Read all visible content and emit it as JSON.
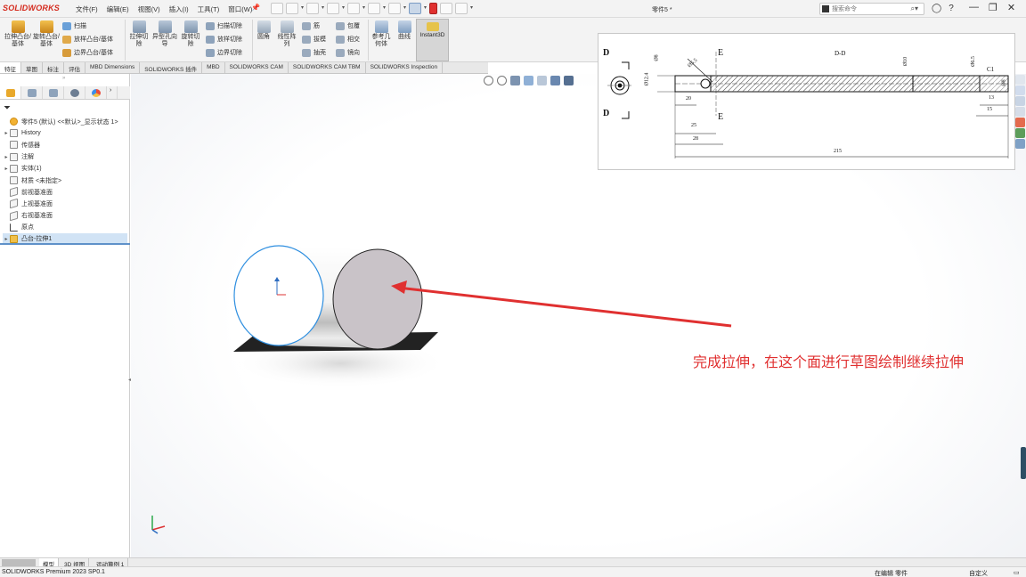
{
  "app": {
    "logo": "SOLIDWORKS",
    "document_title": "零件5 *"
  },
  "menu": [
    "文件(F)",
    "编辑(E)",
    "视图(V)",
    "插入(I)",
    "工具(T)",
    "窗口(W)"
  ],
  "search": {
    "placeholder": "搜索命令"
  },
  "ribbon": {
    "extrude_boss": "拉伸凸台/基体",
    "revolve_boss": "旋转凸台/基体",
    "sweep": "扫描",
    "loft_boss": "放样凸台/基体",
    "boundary_boss": "边界凸台/基体",
    "extrude_cut": "拉伸切除",
    "hole_wizard": "异型孔向导",
    "revolve_cut": "旋转切除",
    "sweep_cut": "扫描切除",
    "loft_cut": "放样切除",
    "boundary_cut": "边界切除",
    "fillet": "圆角",
    "linear_pattern": "线性阵列",
    "rib": "筋",
    "draft": "拔模",
    "shell": "抽壳",
    "wrap": "包覆",
    "intersect": "相交",
    "mirror": "镜向",
    "reference_geometry": "参考几何体",
    "curves": "曲线",
    "instant3d": "Instant3D"
  },
  "tabs": [
    "特征",
    "草图",
    "标注",
    "评估",
    "MBD Dimensions",
    "SOLIDWORKS 插件",
    "MBD",
    "SOLIDWORKS CAM",
    "SOLIDWORKS CAM TBM",
    "SOLIDWORKS Inspection"
  ],
  "tree": {
    "root": "零件5 (默认) <<默认>_显示状态 1>",
    "items": [
      "History",
      "传感器",
      "注解",
      "实体(1)",
      "材质 <未指定>",
      "前视基准面",
      "上视基准面",
      "右视基准面",
      "原点",
      "凸台-拉伸1"
    ]
  },
  "drawing": {
    "section_label": "D-D",
    "label_d": "D",
    "label_e": "E",
    "dims": [
      "Ø8",
      "Ø12.4",
      "Ø5.5",
      "20",
      "25",
      "28",
      "Ø10",
      "Ø6.5",
      "C1",
      "Ø8",
      "13",
      "15",
      "215"
    ]
  },
  "annotation": "完成拉伸，在这个面进行草图绘制继续拉伸",
  "bottom_tabs": [
    "模型",
    "3D 视图",
    "运动算例 1"
  ],
  "status": {
    "version": "SOLIDWORKS Premium 2023 SP0.1",
    "editing": "在编辑 零件",
    "custom": "自定义"
  },
  "colors": {
    "logo_red": "#d52b1e",
    "annotation_red": "#e03030",
    "highlight_blue": "#2f8fe0"
  }
}
